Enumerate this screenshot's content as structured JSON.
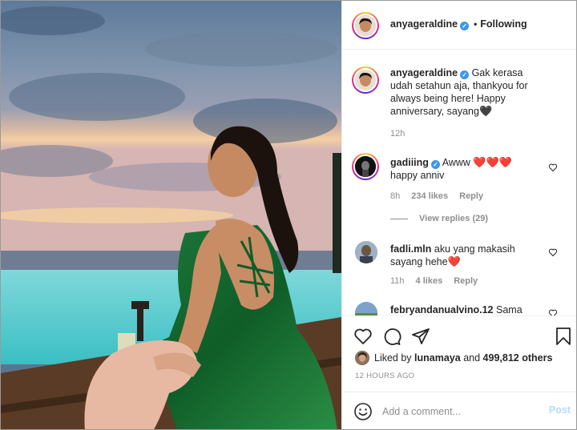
{
  "post": {
    "author": "anyageraldine",
    "follow_status": "Following",
    "separator": "•"
  },
  "caption": {
    "username": "anyageraldine",
    "text": "Gak kerasa udah setahun aja, thankyou for always being here! Happy anniversary, sayang",
    "emoji": "🖤",
    "age": "12h"
  },
  "comments": [
    {
      "username": "gadiiing",
      "verified": true,
      "text_line1": "Awww",
      "emoji": "❤️❤️❤️",
      "text_line2": "happy anniv",
      "age": "8h",
      "likes": "234 likes",
      "reply": "Reply",
      "view_replies": "View replies (29)"
    },
    {
      "username": "fadli.mln",
      "verified": false,
      "text": "aku yang makasih sayang hehe",
      "emoji": "❤️",
      "age": "11h",
      "likes": "4 likes",
      "reply": "Reply"
    },
    {
      "username": "febryandanualvino.12",
      "verified": false,
      "text": "Sama"
    }
  ],
  "liked_by": {
    "prefix": "Liked by",
    "user": "lunamaya",
    "connector": "and",
    "others": "499,812 others"
  },
  "timestamp": "12 HOURS AGO",
  "add_comment": {
    "placeholder": "Add a comment...",
    "post_label": "Post"
  },
  "icons": [
    "heart-icon",
    "comment-icon",
    "share-icon",
    "bookmark-icon",
    "smile-icon",
    "verified-icon"
  ],
  "colors": {
    "verified": "#3897f0",
    "heart": "#e0202b",
    "muted": "#8e8e8e",
    "post_button": "#b2dffc"
  }
}
